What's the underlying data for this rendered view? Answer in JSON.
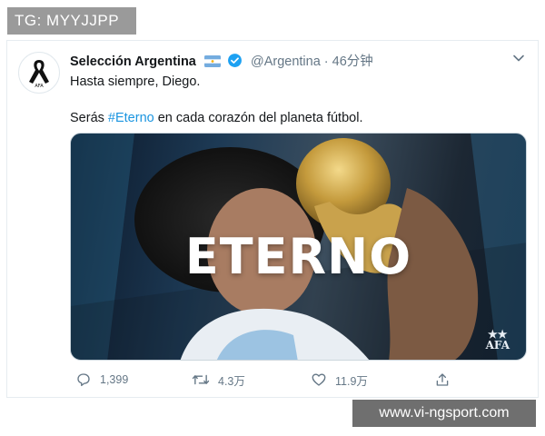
{
  "watermark_top": "TG: MYYJJPP",
  "watermark_bottom": "www.vi-ngsport.com",
  "tweet": {
    "display_name": "Selección Argentina",
    "handle": "@Argentina",
    "separator": "·",
    "time": "46分钟",
    "text_line1": "Hasta siempre, Diego.",
    "text_line2_before": "Serás ",
    "hashtag": "#Eterno",
    "text_line2_after": " en cada corazón del planeta fútbol.",
    "media": {
      "overlay_text": "ETERNO",
      "badge_text": "AFA"
    },
    "actions": {
      "reply_count": "1,399",
      "retweet_count": "4.3万",
      "like_count": "11.9万"
    }
  },
  "colors": {
    "link": "#1b95e0",
    "secondary_text": "#657786",
    "verified": "#1da1f2"
  },
  "icons": [
    "mourning-ribbon-icon",
    "argentina-flag-icon",
    "verified-icon",
    "chevron-down-icon",
    "reply-icon",
    "retweet-icon",
    "like-icon",
    "share-icon"
  ]
}
